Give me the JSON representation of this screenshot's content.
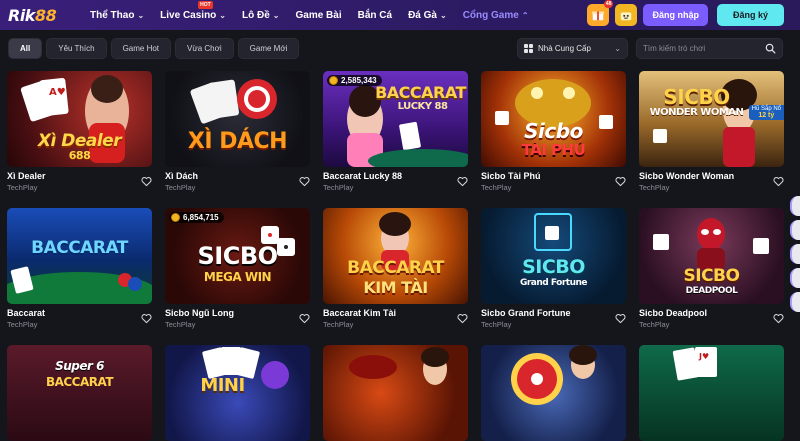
{
  "brand": {
    "logo_text": "Rik",
    "logo_num": "88"
  },
  "nav": {
    "items": [
      {
        "label": "Thể Thao",
        "chevron": true
      },
      {
        "label": "Live Casino",
        "chevron": true,
        "badge": "HOT"
      },
      {
        "label": "Lô Đề",
        "chevron": true
      },
      {
        "label": "Game Bài",
        "chevron": false
      },
      {
        "label": "Bắn Cá",
        "chevron": false
      },
      {
        "label": "Đá Gà",
        "chevron": true
      },
      {
        "label": "Cổng Game",
        "chevron": true,
        "active": true
      }
    ],
    "gift_badge": "48",
    "login_label": "Đăng nhập",
    "register_label": "Đăng ký"
  },
  "filters": {
    "chips": [
      "All",
      "Yêu Thích",
      "Game Hot",
      "Vừa Chơi",
      "Game Mới"
    ],
    "active": "All",
    "provider_label": "Nhà Cung Cấp",
    "search_placeholder": "Tìm kiếm trò chơi"
  },
  "games": [
    {
      "name": "Xì Dealer",
      "provider": "TechPlay",
      "art": "Xì Dealer",
      "art2": "688",
      "theme": "dealer"
    },
    {
      "name": "Xì Dách",
      "provider": "TechPlay",
      "art": "XÌ DÁCH",
      "theme": "xidach"
    },
    {
      "name": "Baccarat Lucky 88",
      "provider": "TechPlay",
      "art": "BACCARAT",
      "art2": "LUCKY 88",
      "jackpot": "2,585,343",
      "theme": "lucky"
    },
    {
      "name": "Sicbo Tài Phú",
      "provider": "TechPlay",
      "art": "Sicbo",
      "art2": "TÀI PHÚ",
      "theme": "taiphu"
    },
    {
      "name": "Sicbo Wonder Woman",
      "provider": "TechPlay",
      "art": "SICBO",
      "art2": "WONDER WOMAN",
      "corner": "Hũ Sắp Nổ",
      "corner2": "12 tỷ",
      "theme": "wonder"
    },
    {
      "name": "Baccarat",
      "provider": "TechPlay",
      "art": "BACCARAT",
      "theme": "baccarat"
    },
    {
      "name": "Sicbo Ngũ Long",
      "provider": "TechPlay",
      "art": "SICBO",
      "art2": "MEGA WIN",
      "jackpot": "6,854,715",
      "theme": "ngulong"
    },
    {
      "name": "Baccarat Kim Tài",
      "provider": "TechPlay",
      "art": "BACCARAT",
      "art2": "KIM TÀI",
      "theme": "kimtai"
    },
    {
      "name": "Sicbo Grand Fortune",
      "provider": "TechPlay",
      "art": "SICBO",
      "art2": "Grand Fortune",
      "theme": "grand"
    },
    {
      "name": "Sicbo Deadpool",
      "provider": "TechPlay",
      "art": "SICBO",
      "art2": "DEADPOOL",
      "theme": "deadpool"
    },
    {
      "name": "",
      "provider": "",
      "art": "Super 6",
      "art2": "BACCARAT",
      "theme": "super6"
    },
    {
      "name": "",
      "provider": "",
      "art": "MINI",
      "theme": "mini"
    },
    {
      "name": "",
      "provider": "",
      "art": "",
      "theme": "bull"
    },
    {
      "name": "",
      "provider": "",
      "art": "",
      "theme": "wheel"
    },
    {
      "name": "",
      "provider": "",
      "art": "",
      "theme": "cards"
    }
  ],
  "colors": {
    "accent": "#7b5cff",
    "register": "#5fe8f0",
    "nav_bg": "#2c1b63",
    "page_bg": "#15151c"
  }
}
